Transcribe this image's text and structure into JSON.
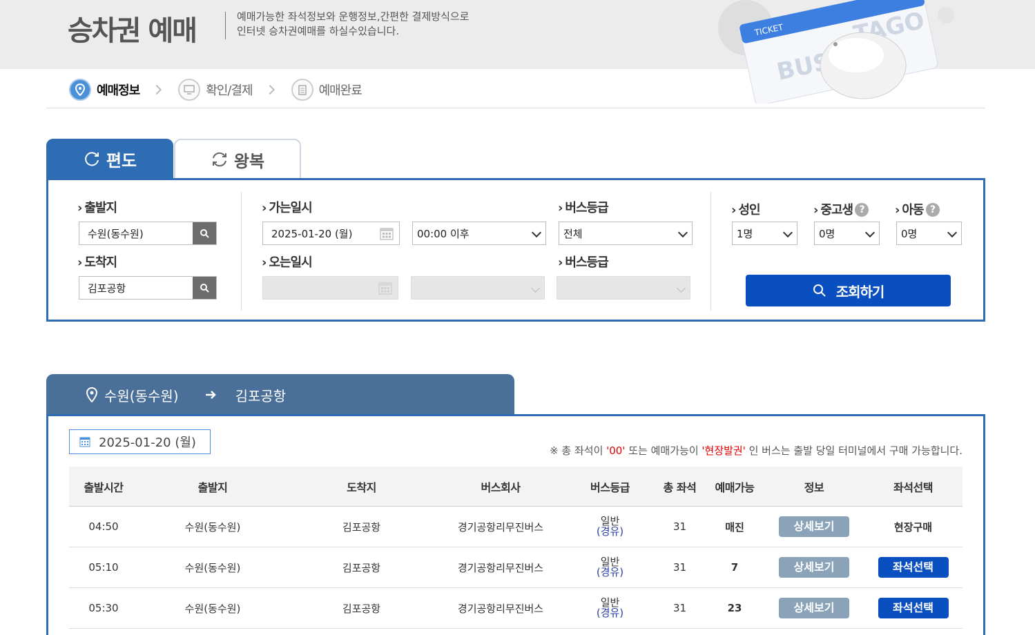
{
  "header": {
    "title": "승차권 예매",
    "desc_line1": "예매가능한 좌석정보와 운행정보,간편한 결제방식으로",
    "desc_line2": "인터넷 승차권예매를 하실수있습니다.",
    "art_ticket_label": "TICKET",
    "art_bus_text": "BUS",
    "art_tago_text": "TAGO"
  },
  "steps": [
    {
      "label": "예매정보",
      "active": true,
      "icon": "location-pin-icon"
    },
    {
      "label": "확인/결제",
      "active": false,
      "icon": "monitor-icon"
    },
    {
      "label": "예매완료",
      "active": false,
      "icon": "document-icon"
    }
  ],
  "tabs": {
    "oneway": "편도",
    "roundtrip": "왕복"
  },
  "search": {
    "departure_label": "출발지",
    "departure_value": "수원(동수원)",
    "arrival_label": "도착지",
    "arrival_value": "김포공항",
    "go_date_label": "가는일시",
    "go_date_value": "2025-01-20 (월)",
    "go_time_value": "00:00 이후",
    "bus_grade_label": "버스등급",
    "bus_grade_value": "전체",
    "return_date_label": "오는일시",
    "return_grade_label": "버스등급",
    "adult_label": "성인",
    "adult_value": "1명",
    "student_label": "중고생",
    "student_value": "0명",
    "child_label": "아동",
    "child_value": "0명",
    "help_glyph": "?",
    "submit_label": "조회하기"
  },
  "route": {
    "from": "수원(동수원)",
    "to": "김포공항"
  },
  "results": {
    "date": "2025-01-20 (월)",
    "notice_prefix": "※ 총 좌석이 ",
    "notice_zero": "'00'",
    "notice_mid": " 또는 예매가능이 ",
    "notice_onsite": "'현장발권'",
    "notice_suffix": " 인 버스는 출발 당일 터미널에서 구매 가능합니다.",
    "columns": [
      "출발시간",
      "출발지",
      "도착지",
      "버스회사",
      "버스등급",
      "총 좌석",
      "예매가능",
      "정보",
      "좌석선택"
    ],
    "rows": [
      {
        "time": "04:50",
        "from": "수원(동수원)",
        "to": "김포공항",
        "company": "경기공항리무진버스",
        "grade": "일반",
        "via": "(경유)",
        "seats": "31",
        "available": "매진",
        "info": "상세보기",
        "seat_action": "현장구매",
        "seat_is_button": false
      },
      {
        "time": "05:10",
        "from": "수원(동수원)",
        "to": "김포공항",
        "company": "경기공항리무진버스",
        "grade": "일반",
        "via": "(경유)",
        "seats": "31",
        "available": "7",
        "info": "상세보기",
        "seat_action": "좌석선택",
        "seat_is_button": true
      },
      {
        "time": "05:30",
        "from": "수원(동수원)",
        "to": "김포공항",
        "company": "경기공항리무진버스",
        "grade": "일반",
        "via": "(경유)",
        "seats": "31",
        "available": "23",
        "info": "상세보기",
        "seat_action": "좌석선택",
        "seat_is_button": true
      }
    ]
  },
  "colors": {
    "primary": "#2e6db4",
    "button_blue": "#0a4fbf",
    "route_tab": "#4a7099",
    "detail_button": "#8aa3b8",
    "notice_red": "#dd0000"
  }
}
